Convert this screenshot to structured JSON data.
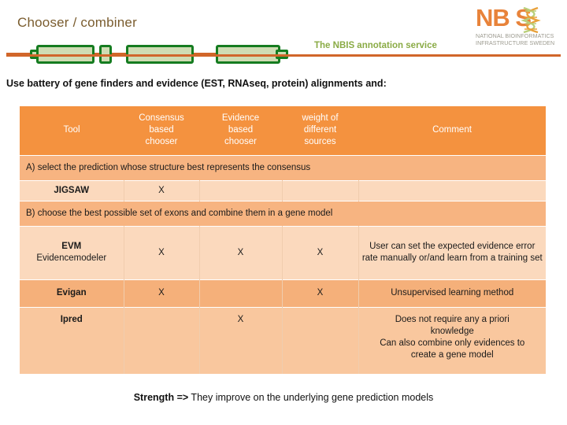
{
  "header": {
    "title": "Chooser / combiner",
    "service_tag": "The NBIS annotation service",
    "logo": {
      "wordmark": "NB S",
      "subtitle_line1": "NATIONAL BIOINFORMATICS",
      "subtitle_line2": "INFRASTRUCTURE SWEDEN",
      "brand_color": "#e8833a",
      "icon": "dna-helix-icon"
    },
    "rule_color": "#d1662a",
    "gene_model": {
      "icon": "gene-structure-icon",
      "axis_color": "#d1662a",
      "exon_fill": "#cfdcb3",
      "exon_stroke": "#157c20"
    }
  },
  "intro": {
    "text": "Use battery of gene finders and evidence (EST, RNAseq, protein) alignments and:"
  },
  "table": {
    "columns": [
      "Tool",
      "Consensus based chooser",
      "Evidence based chooser",
      "weight of different sources",
      "Comment"
    ],
    "column_lines": {
      "consensus": [
        "Consensus",
        "based",
        "chooser"
      ],
      "evidence": [
        "Evidence",
        "based",
        "chooser"
      ],
      "weight": [
        "weight of",
        "different",
        "sources"
      ]
    },
    "header_bg": "#f4923f",
    "header_fg": "#ffffff",
    "sections": [
      {
        "label": "A) select the prediction whose structure best represents the consensus",
        "rows": [
          {
            "tool": "JIGSAW",
            "tool_sub": "",
            "consensus": "X",
            "evidence": "",
            "weight": "",
            "comment": "",
            "tone": "light"
          }
        ]
      },
      {
        "label": "B) choose the best possible set of exons and combine them in a gene model",
        "rows": [
          {
            "tool": "EVM",
            "tool_sub": "Evidencemodeler",
            "consensus": "X",
            "evidence": "X",
            "weight": "X",
            "comment": "User can set the expected evidence error rate manually or/and learn from a training set",
            "tone": "light"
          },
          {
            "tool": "Evigan",
            "tool_sub": "",
            "consensus": "X",
            "evidence": "",
            "weight": "X",
            "comment": "Unsupervised learning method",
            "tone": "dark"
          },
          {
            "tool": "Ipred",
            "tool_sub": "",
            "consensus": "",
            "evidence": "X",
            "weight": "",
            "comment": "Does not require any a priori knowledge Can also combine only evidences to create a gene model",
            "comment_lines": [
              "Does not require any a priori",
              "knowledge",
              "Can also combine only evidences to",
              "create a gene model"
            ],
            "tone": "mid"
          }
        ]
      }
    ]
  },
  "footer": {
    "strong": "Strength =>",
    "text": " They improve on the underlying gene prediction models"
  }
}
